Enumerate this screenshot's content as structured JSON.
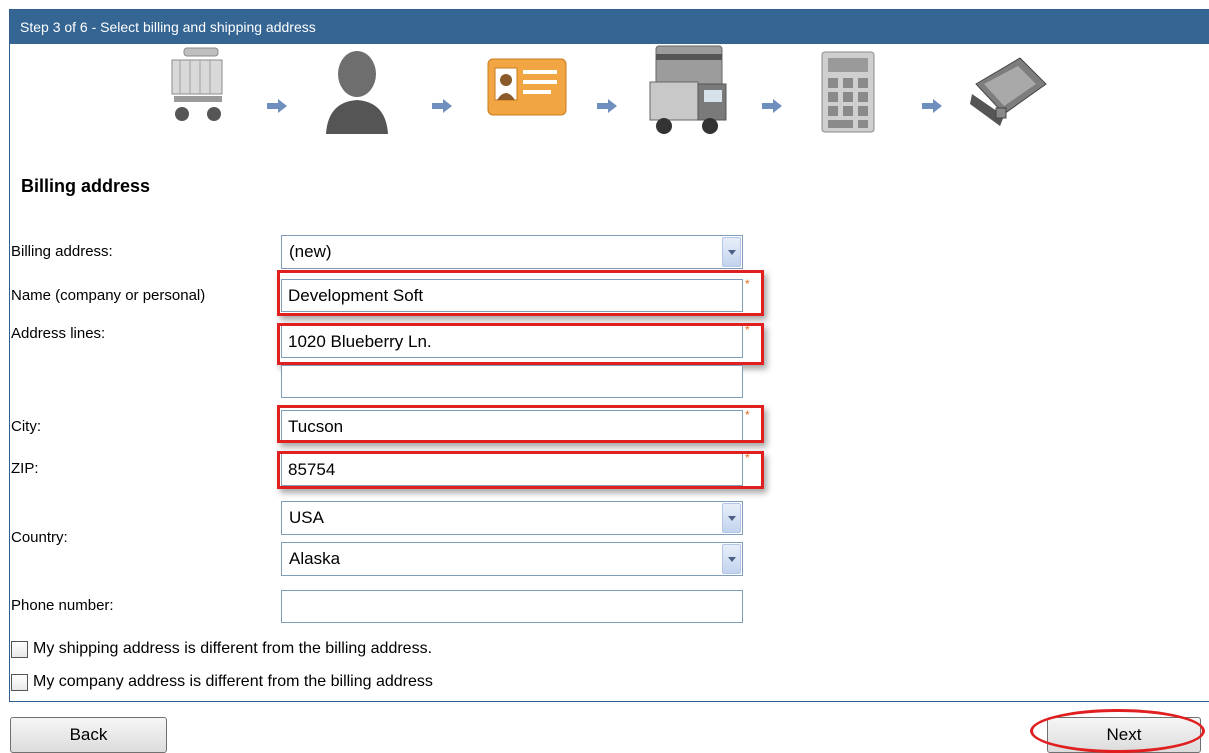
{
  "header": {
    "title": "Step 3 of 6 - Select billing and shipping address"
  },
  "steps": {
    "icons": [
      "shopping-cart-icon",
      "user-icon",
      "id-card-icon",
      "shipping-truck-icon",
      "calculator-icon",
      "wallet-icon"
    ],
    "active_index": 2
  },
  "section": {
    "title": "Billing address"
  },
  "form": {
    "billing_address": {
      "label": "Billing address:",
      "value": "(new)"
    },
    "name": {
      "label": "Name (company or personal)",
      "value": "Development Soft"
    },
    "address": {
      "label": "Address lines:",
      "line1": "1020 Blueberry Ln.",
      "line2": ""
    },
    "city": {
      "label": "City:",
      "value": "Tucson"
    },
    "zip": {
      "label": "ZIP:",
      "value": "85754"
    },
    "country": {
      "label": "Country:",
      "value": "USA",
      "state": "Alaska"
    },
    "phone": {
      "label": "Phone number:",
      "value": ""
    },
    "required_mark": "*"
  },
  "checkboxes": {
    "shipping_different": "My shipping address is different from the billing address.",
    "company_different": "My company address is different from the billing address"
  },
  "buttons": {
    "back": "Back",
    "next": "Next"
  },
  "colors": {
    "header_bg": "#346593",
    "highlight": "#e02020",
    "required": "#e07020"
  }
}
